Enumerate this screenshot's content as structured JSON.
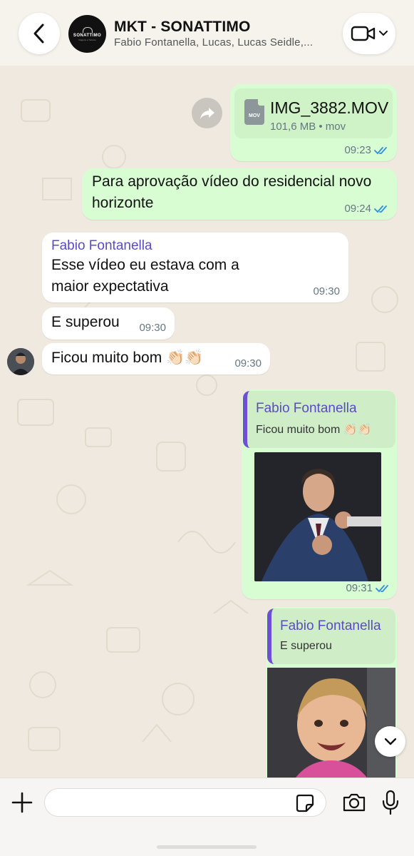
{
  "header": {
    "title": "MKT - SONATTIMO",
    "members": "Fabio Fontanella, Lucas, Lucas Seidle,...",
    "avatar_logo_text": "SONATTIMO",
    "avatar_logo_sub": "Viagens e Turismo"
  },
  "messages": {
    "file": {
      "name": "IMG_3882.MOV",
      "info": "101,6 MB • mov",
      "badge": "MOV",
      "time": "09:23"
    },
    "approval": {
      "text": "Para aprovação vídeo do residencial novo horizonte",
      "time": "09:24"
    },
    "expectation": {
      "sender": "Fabio Fontanella",
      "text": "Esse vídeo eu estava com a maior expectativa",
      "time": "09:30"
    },
    "superou": {
      "text": "E superou",
      "time": "09:30"
    },
    "muito_bom": {
      "text": "Ficou muito bom 👏🏻👏🏻",
      "time": "09:30"
    },
    "reply_gif_1": {
      "quote_sender": "Fabio Fontanella",
      "quote_text": "Ficou muito bom 👏🏻👏🏻",
      "time": "09:31"
    },
    "reply_gif_2": {
      "quote_sender": "Fabio Fontanella",
      "quote_text": "E superou"
    }
  },
  "composer": {
    "placeholder": ""
  },
  "colors": {
    "outgoing_bubble": "#d9fdd3",
    "incoming_bubble": "#ffffff",
    "sender_name": "#5b4bc4",
    "read_ticks": "#2f8fe0",
    "chat_background": "#efe9df"
  }
}
